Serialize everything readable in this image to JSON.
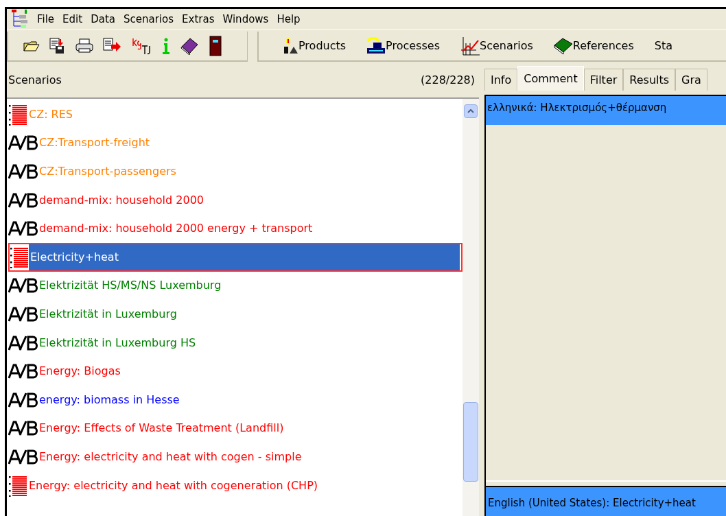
{
  "menu": [
    "File",
    "Edit",
    "Data",
    "Scenarios",
    "Extras",
    "Windows",
    "Help"
  ],
  "toolbar": {
    "buttons": [
      {
        "kind": "products",
        "label": "Products"
      },
      {
        "kind": "processes",
        "label": "Processes"
      },
      {
        "kind": "scenarios",
        "label": "Scenarios"
      },
      {
        "kind": "references",
        "label": "References"
      },
      {
        "kind": "plain",
        "label": "Sta"
      }
    ]
  },
  "left_panel": {
    "title": "Scenarios",
    "count": "(228/228)",
    "items": [
      {
        "kind": "list",
        "label": "CZ: RES",
        "color": "#ff8000",
        "selected": false
      },
      {
        "kind": "ab",
        "label": "CZ:Transport-freight",
        "color": "#ff8000",
        "selected": false
      },
      {
        "kind": "ab",
        "label": "CZ:Transport-passengers",
        "color": "#ff8000",
        "selected": false
      },
      {
        "kind": "ab",
        "label": "demand-mix: household 2000",
        "color": "#ff0000",
        "selected": false
      },
      {
        "kind": "ab",
        "label": "demand-mix: household 2000 energy + transport",
        "color": "#ff0000",
        "selected": false
      },
      {
        "kind": "list",
        "label": "Electricity+heat",
        "selected": true
      },
      {
        "kind": "ab",
        "label": "Elektrizität HS/MS/NS Luxemburg",
        "color": "#008000",
        "selected": false
      },
      {
        "kind": "ab",
        "label": "Elektrizität in Luxemburg",
        "color": "#008000",
        "selected": false
      },
      {
        "kind": "ab",
        "label": "Elektrizität in Luxemburg HS",
        "color": "#008000",
        "selected": false
      },
      {
        "kind": "ab",
        "label": "Energy: Biogas",
        "color": "#ff0000",
        "selected": false
      },
      {
        "kind": "ab",
        "label": "energy: biomass in Hesse",
        "color": "#0000ff",
        "selected": false
      },
      {
        "kind": "ab",
        "label": "Energy: Effects of Waste Treatment (Landfill)",
        "color": "#ff0000",
        "selected": false
      },
      {
        "kind": "ab",
        "label": "Energy: electricity and heat with cogen - simple",
        "color": "#ff0000",
        "selected": false
      },
      {
        "kind": "list",
        "label": "Energy: electricity and heat with cogeneration (CHP)",
        "color": "#ff0000",
        "selected": false
      }
    ]
  },
  "right_panel": {
    "tabs": [
      {
        "label": "Info",
        "selected": false
      },
      {
        "label": "Comment",
        "selected": true
      },
      {
        "label": "Filter",
        "selected": false
      },
      {
        "label": "Results",
        "selected": false
      },
      {
        "label": "Gra",
        "selected": false
      }
    ],
    "comment_top": "ελληνικά: Ηλεκτρισμός+θέρμανση",
    "comment_bottom": "English (United States): Electricity+heat"
  }
}
